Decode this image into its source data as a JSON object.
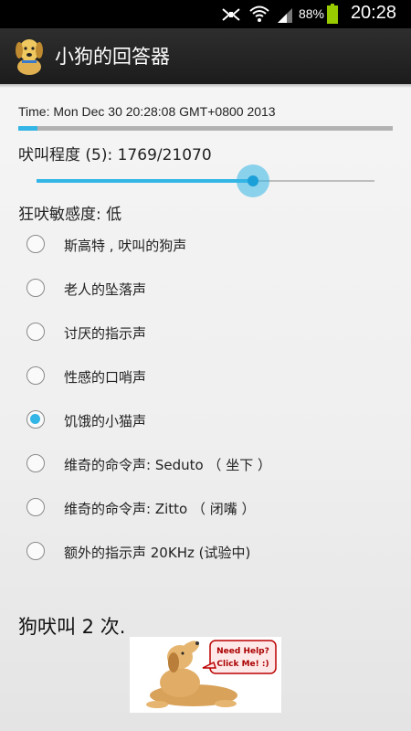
{
  "status_bar": {
    "battery_percent": "88%",
    "time": "20:28",
    "icons": [
      "notification-icon",
      "wifi-icon",
      "signal-icon",
      "battery-icon"
    ]
  },
  "action_bar": {
    "app_title": "小狗的回答器",
    "app_icon": "dog-icon"
  },
  "main": {
    "time_text": "Time: Mon Dec 30 20:28:08 GMT+0800 2013",
    "progress_fraction": 0.05,
    "bark_level_text": "吠叫程度 (5): 1769/21070",
    "slider_fraction": 0.64,
    "sensitivity_text": "狂吠敏感度: 低",
    "sound_options": [
      {
        "label": "斯高特 , 吠叫的狗声",
        "checked": false
      },
      {
        "label": "老人的坠落声",
        "checked": false
      },
      {
        "label": "讨厌的指示声",
        "checked": false
      },
      {
        "label": "性感的口哨声",
        "checked": false
      },
      {
        "label": "饥饿的小猫声",
        "checked": true
      },
      {
        "label": "维奇的命令声: Seduto （ 坐下 ）",
        "checked": false
      },
      {
        "label": "维奇的命令声: Zitto （ 闭嘴 ）",
        "checked": false
      },
      {
        "label": "额外的指示声 20KHz (试验中)",
        "checked": false
      }
    ],
    "bark_count_text": "狗吠叫 2 次.",
    "help_bubble_line1": "Need Help?",
    "help_bubble_line2": "Click Me! :)"
  },
  "colors": {
    "accent": "#33b5e5",
    "action_bar": "#222222",
    "status_bar": "#000000",
    "battery": "#99cc00"
  }
}
